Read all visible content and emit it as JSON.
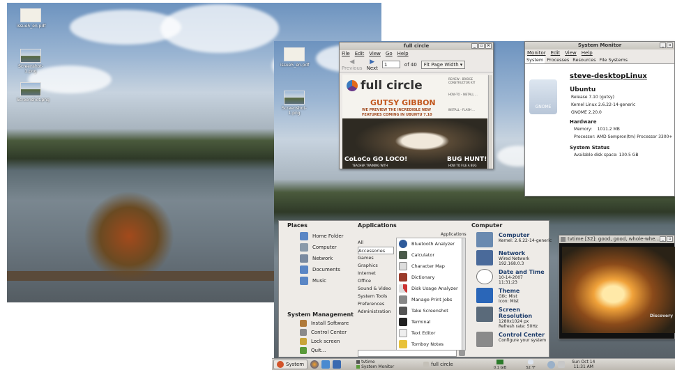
{
  "desktop_left": {
    "icons": [
      {
        "label": "issue5_en.pdf"
      },
      {
        "label": "Screenshot-1.png"
      },
      {
        "label": "Screenshot.png"
      }
    ]
  },
  "desktop_right": {
    "icons": [
      {
        "label": "issue5_en.pdf"
      },
      {
        "label": "Screenshot-1.png"
      }
    ]
  },
  "pdf_window": {
    "title": "full circle",
    "menu": [
      "File",
      "Edit",
      "View",
      "Go",
      "Help"
    ],
    "toolbar": {
      "previous": "Previous",
      "next": "Next",
      "page_value": "1",
      "page_of": "of 40",
      "zoom": "Fit Page Width"
    },
    "page": {
      "masthead": "full circle",
      "headline": "GUTSY GIBBON",
      "subhead1": "WE PREVIEW THE INCREDIBLE NEW",
      "subhead2": "FEATURES COMING IN UBUNTU 7.10",
      "left_banner": "CoLoCo GO LOCO!",
      "left_sub": "TEACHER TRAINING WITH",
      "right_banner": "BUG HUNT!",
      "right_sub": "HOW TO FILE A BUG",
      "side1": "REVIEW - BRIDGE CONSTRUCTOR KIT",
      "side2": "HOW-TO - INSTALL ...",
      "side3": "INSTALL - FLASH ..."
    }
  },
  "sysmon": {
    "title": "System Monitor",
    "menu": [
      "Monitor",
      "Edit",
      "View",
      "Help"
    ],
    "tabs": [
      "System",
      "Processes",
      "Resources",
      "File Systems"
    ],
    "hostname": "steve-desktopLinux",
    "logo": "GNOME",
    "os_name": "Ubuntu",
    "release": "Release 7.10 (gutsy)",
    "kernel": "Kernel Linux 2.6.22-14-generic",
    "gnome": "GNOME 2.20.0",
    "hw_heading": "Hardware",
    "memory": "Memory:    1011.2 MB",
    "processor": "Processor: AMD Sempron(tm) Processor 3300+",
    "status_heading": "System Status",
    "disk": "Available disk space: 130.5 GB"
  },
  "menu": {
    "places_heading": "Places",
    "places": [
      "Home Folder",
      "Computer",
      "Network",
      "Documents",
      "Music"
    ],
    "sysmgmt_heading": "System Management",
    "sysmgmt": [
      "Install Software",
      "Control Center",
      "Lock screen",
      "Quit..."
    ],
    "apps_heading": "Applications",
    "apps_sub": "Applications",
    "categories": [
      "All",
      "Accessories",
      "Games",
      "Graphics",
      "Internet",
      "Office",
      "Sound & Video",
      "System Tools",
      "Preferences",
      "Administration"
    ],
    "apps": [
      "Bluetooth Analyzer",
      "Calculator",
      "Character Map",
      "Dictionary",
      "Disk Usage Analyzer",
      "Manage Print Jobs",
      "Take Screenshot",
      "Terminal",
      "Text Editor",
      "Tomboy Notes"
    ],
    "computer_heading": "Computer",
    "computer_items": [
      {
        "title": "Computer",
        "l1": "Kernel: 2.6.22-14-generic",
        "l2": ""
      },
      {
        "title": "Network",
        "l1": "Wired Network",
        "l2": "192.168.0.3"
      },
      {
        "title": "Date and Time",
        "l1": "10-14-2007",
        "l2": "11:31:23"
      },
      {
        "title": "Theme",
        "l1": "Gtk: Mist",
        "l2": "Icon: Mist"
      },
      {
        "title": "Screen Resolution",
        "l1": "1280x1024 px",
        "l2": "Refresh rate: 50Hz"
      },
      {
        "title": "Control Center",
        "l1": "Configure your system",
        "l2": ""
      }
    ]
  },
  "video": {
    "title": "tvtime [32]: good, good, whole-whe...",
    "channel_logo": "Discovery"
  },
  "taskbar": {
    "system": "System",
    "tasks": [
      {
        "label": "tvtime"
      },
      {
        "label": "System Monitor"
      },
      {
        "label": "full circle"
      }
    ],
    "weather": "52 °F",
    "date": "Sun Oct 14",
    "time": "11:31 AM",
    "tray": "0.1 GiB"
  }
}
